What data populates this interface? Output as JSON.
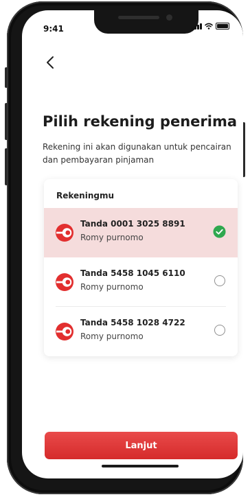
{
  "status_bar": {
    "time": "9:41"
  },
  "header": {
    "back_icon": "chevron-left-icon"
  },
  "page": {
    "title": "Pilih rekening penerima",
    "subtitle": "Rekening ini akan digunakan untuk pencairan dan pembayaran pinjaman"
  },
  "accounts_card": {
    "header": "Rekeningmu",
    "accounts": [
      {
        "number": "Tanda 0001 3025 8891",
        "name": "Romy purnomo",
        "selected": true
      },
      {
        "number": "Tanda 5458 1045 6110",
        "name": "Romy purnomo",
        "selected": false
      },
      {
        "number": "Tanda 5458 1028 4722",
        "name": "Romy purnomo",
        "selected": false
      }
    ]
  },
  "footer": {
    "continue_label": "Lanjut"
  },
  "colors": {
    "accent": "#d52a2a",
    "selected_background": "#f5dcdc",
    "check_green": "#2fa84f"
  }
}
